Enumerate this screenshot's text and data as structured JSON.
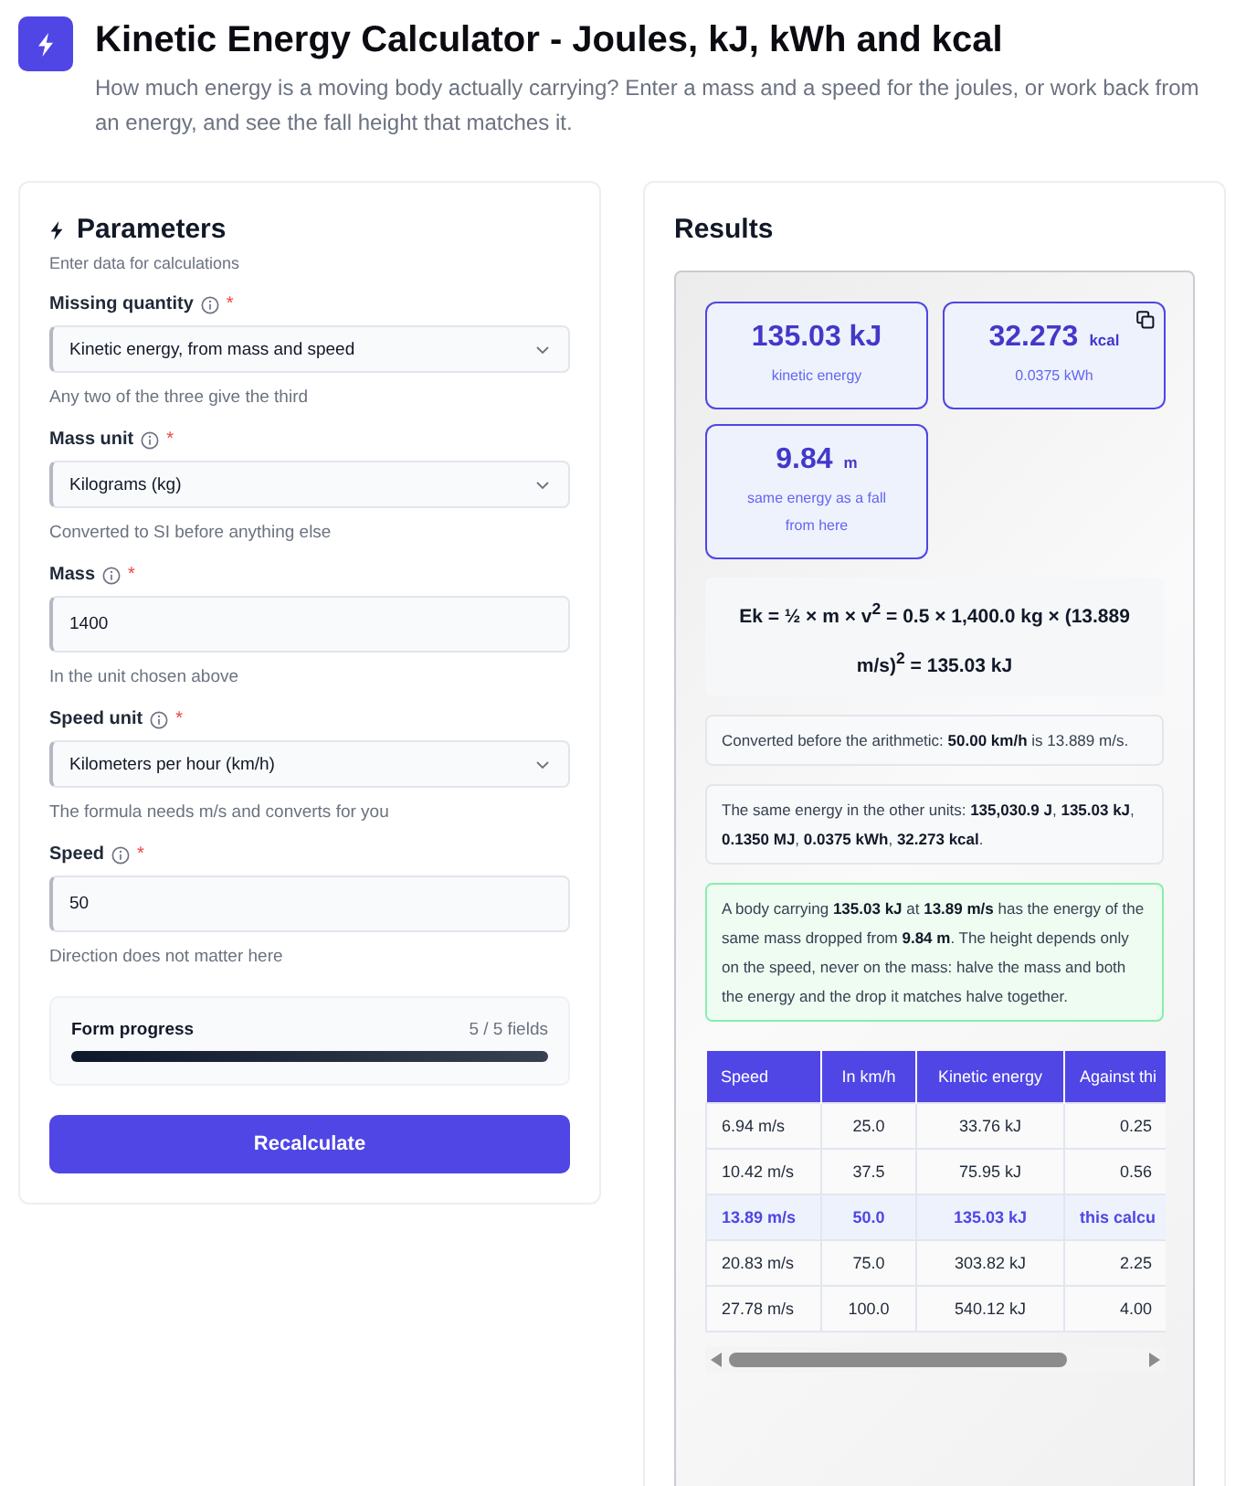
{
  "header": {
    "title": "Kinetic Energy Calculator - Joules, kJ, kWh and kcal",
    "subtitle": "How much energy is a moving body actually carrying? Enter a mass and a speed for the joules, or work back from an energy, and see the fall height that matches it."
  },
  "parameters": {
    "title": "Parameters",
    "subtitle": "Enter data for calculations",
    "fields": [
      {
        "kind": "select",
        "label": "Missing quantity",
        "required": "*",
        "value": "Kinetic energy, from mass and speed",
        "hint": "Any two of the three give the third"
      },
      {
        "kind": "select",
        "label": "Mass unit",
        "required": "*",
        "value": "Kilograms (kg)",
        "hint": "Converted to SI before anything else"
      },
      {
        "kind": "input",
        "label": "Mass",
        "required": "*",
        "value": "1400",
        "hint": "In the unit chosen above"
      },
      {
        "kind": "select",
        "label": "Speed unit",
        "required": "*",
        "value": "Kilometers per hour (km/h)",
        "hint": "The formula needs m/s and converts for you"
      },
      {
        "kind": "input",
        "label": "Speed",
        "required": "*",
        "value": "50",
        "hint": "Direction does not matter here"
      }
    ],
    "progress": {
      "label": "Form progress",
      "count": "5 / 5 fields",
      "level": 1
    },
    "button": "Recalculate"
  },
  "results": {
    "title": "Results",
    "metrics": [
      {
        "value": "135.03 kJ",
        "caption": "kinetic energy",
        "copy_button": false
      },
      {
        "value": "32.273",
        "unit": "kcal",
        "caption": "0.0375 kWh",
        "copy_button": true
      },
      {
        "value": "9.84",
        "unit": "m",
        "caption": "same energy as a fall from here",
        "copy_button": false
      }
    ],
    "formula": "Ek = ½ × m × v$^{2}$ = 0.5 × 1,400.0 kg × (13.889 m/s)$^{2}$ = 135.03 kJ",
    "notes": [
      {
        "kind": "info",
        "text": "Converted before the arithmetic: **50.00 km/h** is 13.889 m/s."
      },
      {
        "kind": "info",
        "text": "The same energy in the other units: **135,030.9 J**, **135.03 kJ**, **0.1350 MJ**, **0.0375 kWh**, **32.273 kcal**."
      },
      {
        "kind": "success",
        "text": "A body carrying **135.03 kJ** at **13.89 m/s** has the energy of the same mass dropped from **9.84 m**. The height depends only on the speed, never on the mass: halve the mass and both the energy and the drop it matches halve together."
      }
    ],
    "table": {
      "columns": [
        "Speed",
        "In km/h",
        "Kinetic energy",
        "Against thi"
      ],
      "rows": [
        {
          "cells": [
            "6.94 m/s",
            "25.0",
            "33.76 kJ",
            "0.25"
          ],
          "selected": false
        },
        {
          "cells": [
            "10.42 m/s",
            "37.5",
            "75.95 kJ",
            "0.56"
          ],
          "selected": false
        },
        {
          "cells": [
            "13.89 m/s",
            "50.0",
            "135.03 kJ",
            "this calcu"
          ],
          "selected": true
        },
        {
          "cells": [
            "20.83 m/s",
            "75.0",
            "303.82 kJ",
            "2.25"
          ],
          "selected": false
        },
        {
          "cells": [
            "27.78 m/s",
            "100.0",
            "540.12 kJ",
            "4.00"
          ],
          "selected": false
        }
      ]
    }
  }
}
